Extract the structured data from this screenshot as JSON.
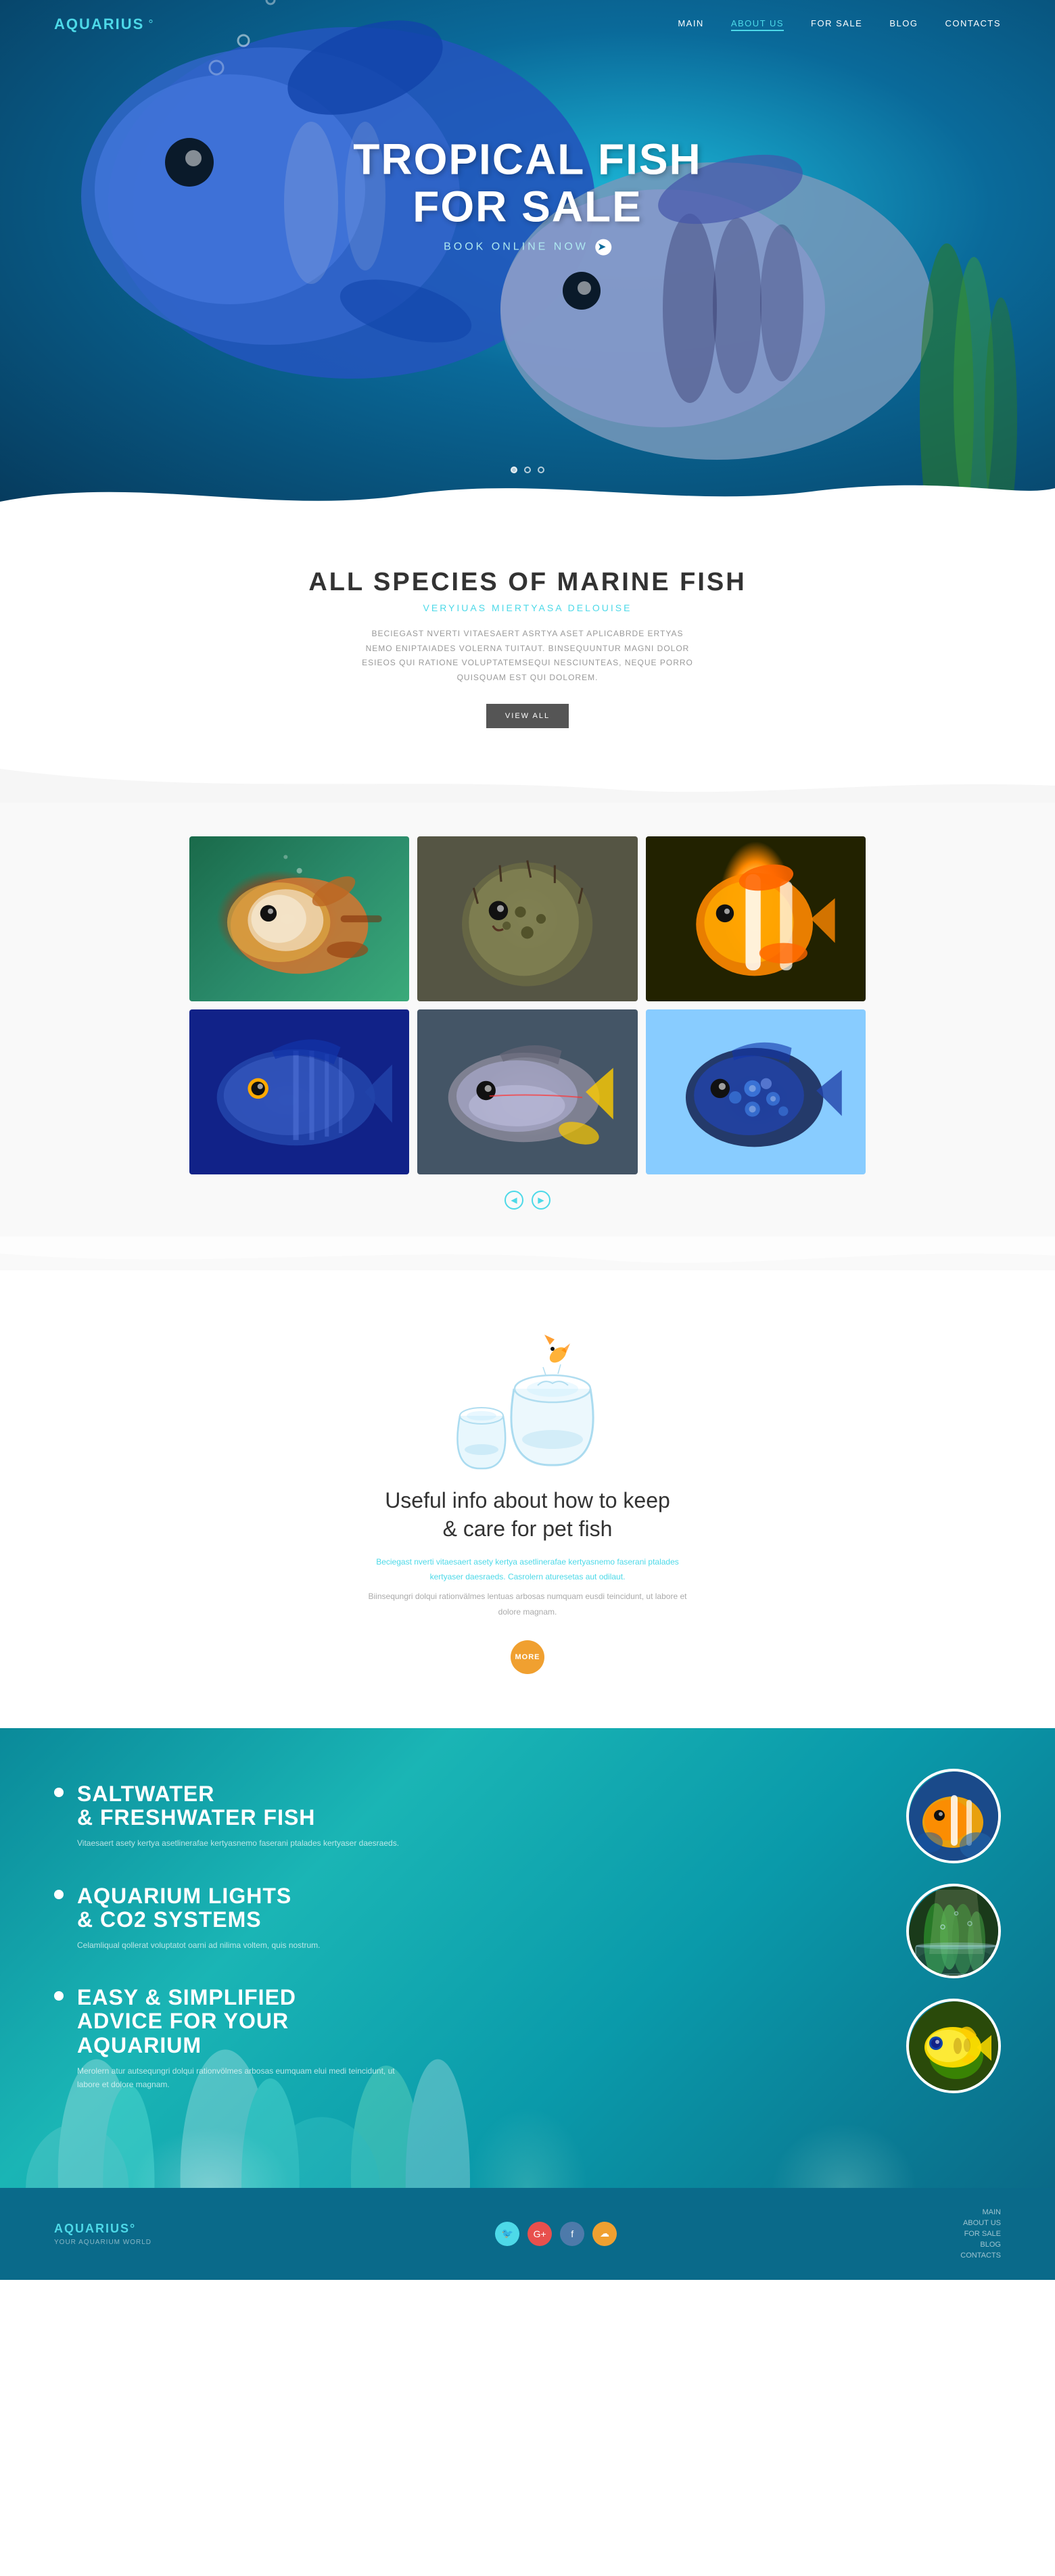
{
  "site": {
    "logo": "AQUARIUS",
    "logo_symbol": "°"
  },
  "nav": {
    "links": [
      {
        "label": "MAIN",
        "active": false
      },
      {
        "label": "ABOUT US",
        "active": true
      },
      {
        "label": "FOR SALE",
        "active": false
      },
      {
        "label": "BLOG",
        "active": false
      },
      {
        "label": "CONTACTS",
        "active": false
      }
    ]
  },
  "hero": {
    "title_line1": "TROPICAL FISH",
    "title_line2": "FOR SALE",
    "cta": "BOOK ONLINE NOW",
    "dots": [
      true,
      false,
      false
    ]
  },
  "marine": {
    "title": "ALL SPECIES OF MARINE FISH",
    "subtitle": "VERYIUAS MIERTYASA DELOUISE",
    "description": "BECIEGAST NVERTI VITAESAERT ASRTYA ASET APLICABRDЕ ERTYAS NEMO ENIPTAIADES VOLERNA TUITAUT. BINSEQUUNTUR MAGNI DOLOR ESIEOS QUI RATIONE VOLUPTATEMSEQUI NESCIUNTEAS, NEQUE PORRO QUISQUAM EST QUI DOLOREM.",
    "view_all": "VIEW ALL"
  },
  "fish_grid": {
    "cells": [
      {
        "id": 1,
        "alt": "Orange white fish"
      },
      {
        "id": 2,
        "alt": "Puffer fish"
      },
      {
        "id": 3,
        "alt": "Clownfish"
      },
      {
        "id": 4,
        "alt": "Blue striped fish"
      },
      {
        "id": 5,
        "alt": "Gray yellow fish"
      },
      {
        "id": 6,
        "alt": "Spotted blue fish"
      }
    ],
    "nav": {
      "prev": "◀",
      "next": "▶"
    }
  },
  "pet_care": {
    "title": "Useful info about how to keep\n& care for pet fish",
    "desc_blue": "Beciegast nverti vitaesaert asety kertya asetlinerafae kertyasnemo faserani ptalades kertyaser daesraeds. Casrolern aturesetas aut odilaut.",
    "desc_gray": "Biinsequngri dolqui rationvälmes lentuas arbosas numquam eusdi teincidunt, ut labore et dolore magnam.",
    "more": "more"
  },
  "features": {
    "items": [
      {
        "title": "SALTWATER\n& FRESHWATER FISH",
        "desc": "Vitaesaert asety kertya asetlinerafae kertyasnemo faserani ptalades kertyaser daesraeds."
      },
      {
        "title": "AQUARIUM LIGHTS\n& CO2 SYSTEMS",
        "desc": "Celamliqual qollerat voluptatot oarni ad nilima voltem, quis nostrum."
      },
      {
        "title": "EASY & SIMPLIFIED\nADVICE FOR YOUR AQUARIUM",
        "desc": "Merolern atur autsequngri dolqui rationvölmes arbosas eumquam elui medi teincidunt, ut labore et dolore magnam."
      }
    ]
  },
  "footer": {
    "logo": "AQUARIUS",
    "logo_symbol": "°",
    "tagline": "YOUR AQUARIUM WORLD",
    "social": [
      "T",
      "G+",
      "f",
      "RSS"
    ],
    "links": [
      "MAIN",
      "ABOUT US",
      "FOR SALE",
      "BLOG",
      "CONTACTS"
    ]
  }
}
